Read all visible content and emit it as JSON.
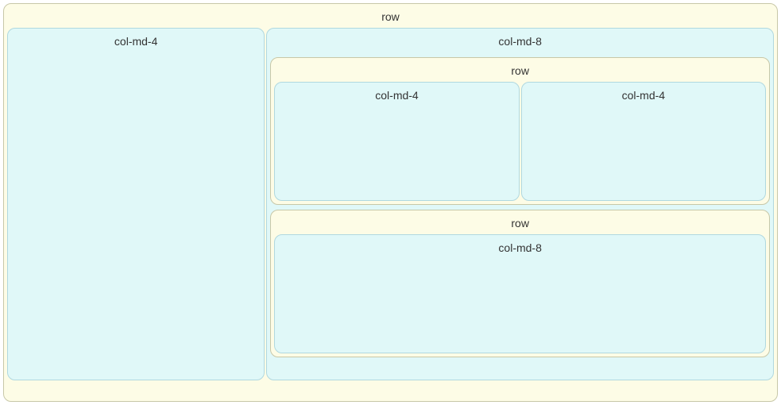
{
  "outerRow": {
    "label": "row"
  },
  "leftCol": {
    "label": "col-md-4"
  },
  "rightCol": {
    "label": "col-md-8"
  },
  "innerRow1": {
    "label": "row"
  },
  "innerRow1Cols": [
    {
      "label": "col-md-4"
    },
    {
      "label": "col-md-4"
    }
  ],
  "innerRow2": {
    "label": "row"
  },
  "innerRow2Col": {
    "label": "col-md-8"
  }
}
